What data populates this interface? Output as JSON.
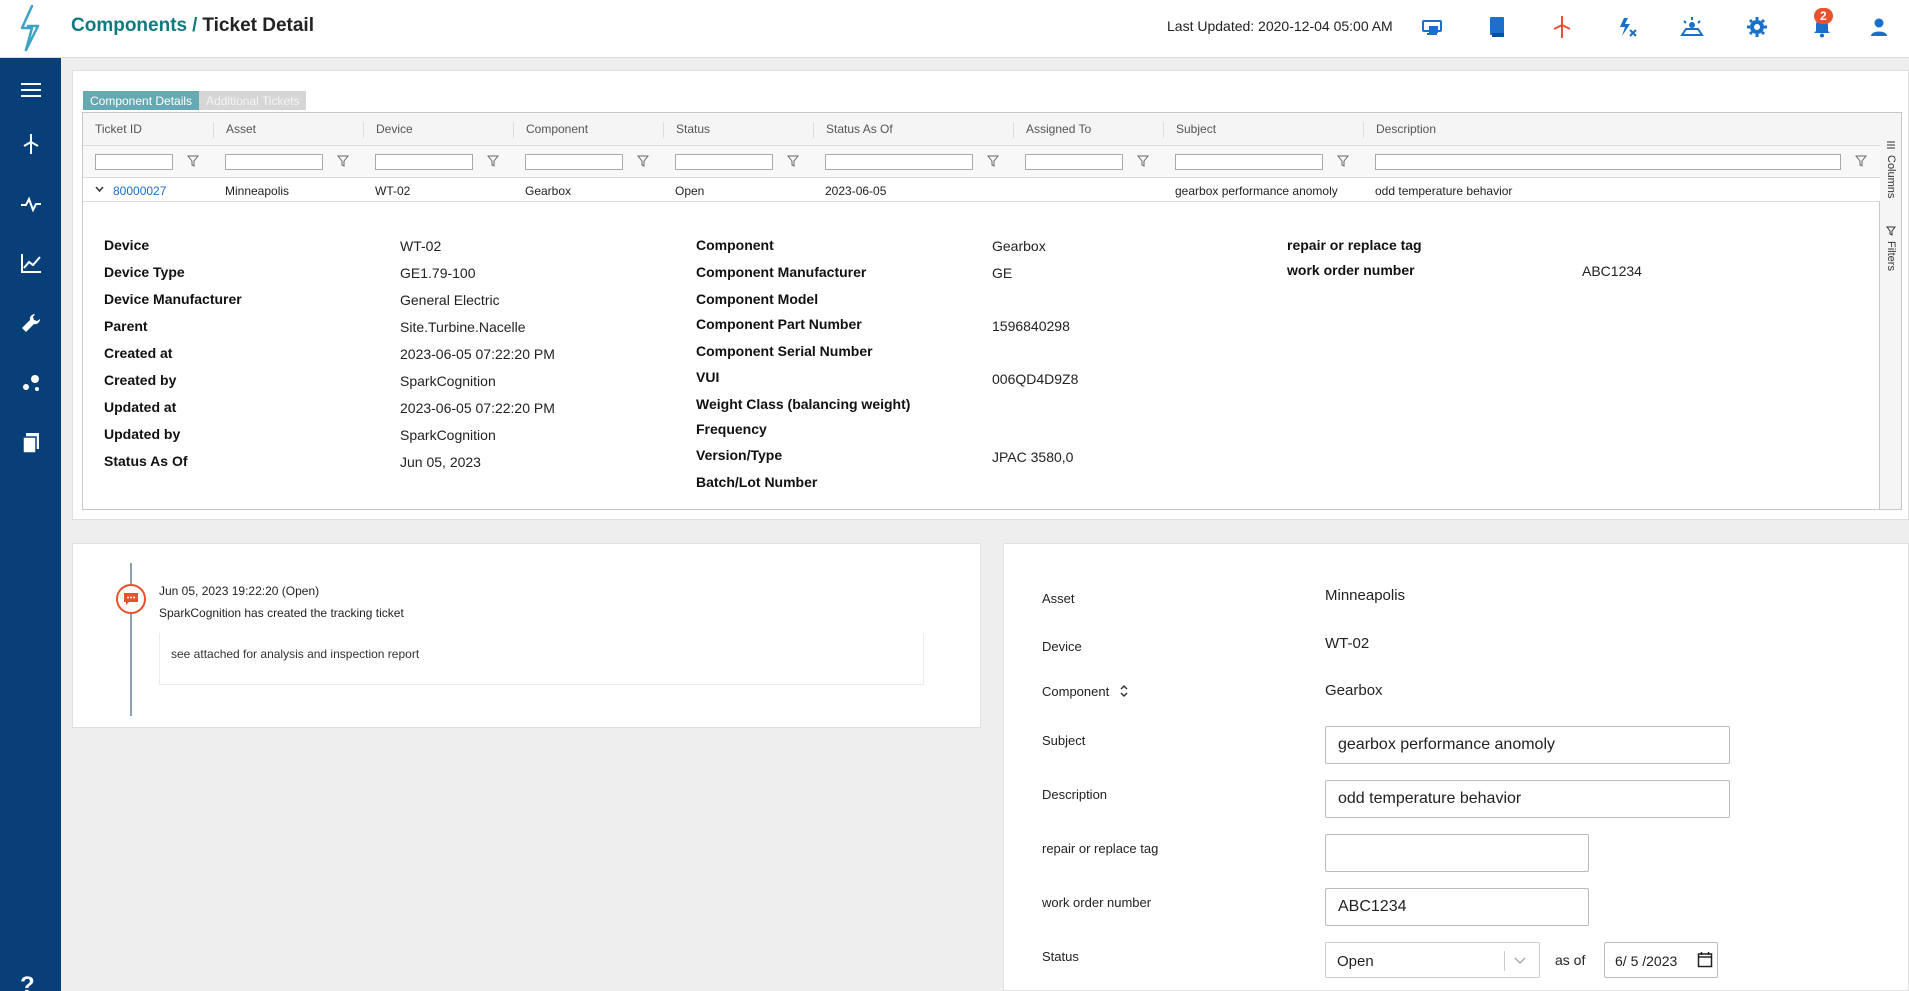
{
  "header": {
    "breadcrumb_parent": "Components",
    "breadcrumb_separator": "/",
    "breadcrumb_current": "Ticket Detail",
    "last_updated": "Last Updated: 2020-12-04 05:00 AM",
    "notification_count": "2",
    "icons": [
      "monitor-icon",
      "book-icon",
      "wind-turbine-icon",
      "power-icon",
      "solar-icon",
      "gear-icon",
      "bell-icon",
      "user-icon"
    ]
  },
  "sidebar": {
    "items": [
      "menu-icon",
      "wind-turbine-icon",
      "pulse-icon",
      "chart-icon",
      "wrench-icon",
      "nodes-icon",
      "documents-icon"
    ],
    "help": "?"
  },
  "tabs": [
    "Component Details",
    "Additional Tickets"
  ],
  "grid": {
    "columns": [
      "Ticket ID",
      "Asset",
      "Device",
      "Component",
      "Status",
      "Status As Of",
      "Assigned To",
      "Subject",
      "Description"
    ],
    "row": {
      "ticket_id": "80000027",
      "asset": "Minneapolis",
      "device": "WT-02",
      "component": "Gearbox",
      "status": "Open",
      "status_as_of": "2023-06-05",
      "assigned_to": "",
      "subject": "gearbox performance anomoly",
      "description": "odd temperature behavior"
    },
    "side_tools": [
      "Columns",
      "Filters"
    ]
  },
  "details": {
    "col1": [
      {
        "label": "Device",
        "value": "WT-02"
      },
      {
        "label": "Device Type",
        "value": "GE1.79-100"
      },
      {
        "label": "Device Manufacturer",
        "value": "General Electric"
      },
      {
        "label": "Parent",
        "value": "Site.Turbine.Nacelle"
      },
      {
        "label": "Created at",
        "value": "2023-06-05 07:22:20 PM"
      },
      {
        "label": "Created by",
        "value": "SparkCognition"
      },
      {
        "label": "Updated at",
        "value": "2023-06-05 07:22:20 PM"
      },
      {
        "label": "Updated by",
        "value": "SparkCognition"
      },
      {
        "label": "Status As Of",
        "value": "Jun 05, 2023"
      }
    ],
    "col2": [
      {
        "label": "Component",
        "value": "Gearbox"
      },
      {
        "label": "Component Manufacturer",
        "value": "GE"
      },
      {
        "label": "Component Model",
        "value": ""
      },
      {
        "label": "Component Part Number",
        "value": "1596840298"
      },
      {
        "label": "Component Serial Number",
        "value": ""
      },
      {
        "label": "VUI",
        "value": "006QD4D9Z8"
      },
      {
        "label": "Weight Class (balancing weight)",
        "value": ""
      },
      {
        "label": "Frequency",
        "value": ""
      },
      {
        "label": "Version/Type",
        "value": "JPAC 3580,0"
      },
      {
        "label": "Batch/Lot Number",
        "value": ""
      }
    ],
    "col3": [
      {
        "label": "repair or replace tag",
        "value": ""
      },
      {
        "label": "work order number",
        "value": "ABC1234"
      }
    ]
  },
  "timeline": {
    "date": "Jun 05, 2023 19:22:20 (Open)",
    "text": "SparkCognition has created the tracking ticket",
    "note": "see attached for analysis and inspection report"
  },
  "form": {
    "asset_label": "Asset",
    "asset_value": "Minneapolis",
    "device_label": "Device",
    "device_value": "WT-02",
    "component_label": "Component",
    "component_value": "Gearbox",
    "subject_label": "Subject",
    "subject_value": "gearbox performance anomoly",
    "description_label": "Description",
    "description_value": "odd temperature behavior",
    "repair_label": "repair or replace tag",
    "repair_value": "",
    "work_order_label": "work order number",
    "work_order_value": "ABC1234",
    "status_label": "Status",
    "status_value": "Open",
    "as_of_label": "as of",
    "as_of_value": "6/ 5 /2023"
  },
  "colors": {
    "sidebar": "#074079",
    "brand_teal": "#0f7a7f",
    "tab_active": "#65a9b3",
    "link": "#1a6fc9",
    "badge": "#e8512c",
    "icon_blue": "#1a6fc9"
  }
}
